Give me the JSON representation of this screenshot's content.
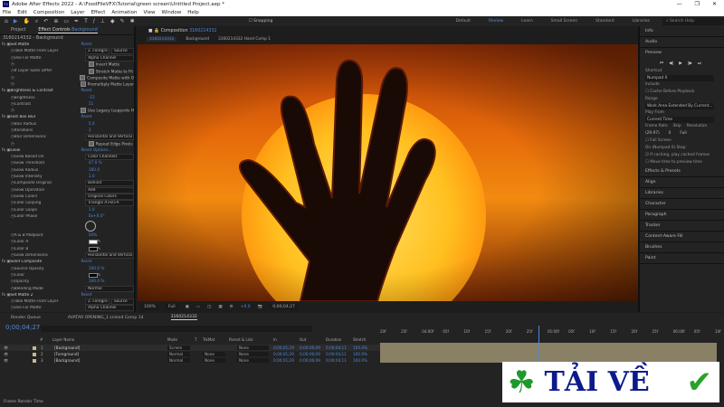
{
  "title": "Adobe After Effects 2022 - A:\\FoodFileVFX\\Tutorial\\green screen\\Untitled Project.aep *",
  "window_controls": [
    "—",
    "❐",
    "✕"
  ],
  "menu": [
    "File",
    "Edit",
    "Composition",
    "Layer",
    "Effect",
    "Animation",
    "View",
    "Window",
    "Help"
  ],
  "toolbar": {
    "snapping": "Snapping",
    "workspaces": [
      "Default",
      "Review",
      "Learn",
      "Small Screen",
      "Standard",
      "Libraries"
    ],
    "active_workspace": "Review",
    "search_placeholder": "Search Help"
  },
  "left_panel": {
    "tabs": [
      "Project",
      "Effect Controls"
    ],
    "effect_controls_layer": "Background",
    "layer_title": "3160214332 - Background",
    "rows": [
      {
        "t": "fx",
        "n": "Set Matte",
        "v": "Reset"
      },
      {
        "t": "dd2",
        "n": "Take Matte From Layer",
        "v": "2. Foregro",
        "v2": "Source"
      },
      {
        "t": "dd",
        "n": "Use For Matte",
        "v": "Alpha Channel"
      },
      {
        "t": "cb",
        "n": "",
        "v": "Invert Matte"
      },
      {
        "t": "cb",
        "n": "If Layer Sizes Differ",
        "v": "Stretch Matte to Fit"
      },
      {
        "t": "cb",
        "n": "",
        "v": "Composite Matte with O"
      },
      {
        "t": "cb",
        "n": "",
        "v": "Premultiply Matte Layer"
      },
      {
        "t": "fx",
        "n": "Brightness & Contrast",
        "v": "Reset"
      },
      {
        "t": "val",
        "n": "Brightness",
        "v": "-15"
      },
      {
        "t": "val",
        "n": "Contrast",
        "v": "11"
      },
      {
        "t": "cb",
        "n": "",
        "v": "Use Legacy (supports H"
      },
      {
        "t": "fx",
        "n": "Fast Box Blur",
        "v": "Reset"
      },
      {
        "t": "val",
        "n": "Blur Radius",
        "v": "5.0"
      },
      {
        "t": "val",
        "n": "Iterations",
        "v": "3"
      },
      {
        "t": "dd",
        "n": "Blur Dimensions",
        "v": "Horizontal and Vertical"
      },
      {
        "t": "cb",
        "n": "",
        "v": "Repeat Edge Pixels"
      },
      {
        "t": "fx",
        "n": "Glow",
        "v": "Reset   Options..."
      },
      {
        "t": "dd",
        "n": "Glow Based On",
        "v": "Color Channels"
      },
      {
        "t": "val",
        "n": "Glow Threshold",
        "v": "47.0 %"
      },
      {
        "t": "val",
        "n": "Glow Radius",
        "v": "160.0"
      },
      {
        "t": "val",
        "n": "Glow Intensity",
        "v": "1.0"
      },
      {
        "t": "dd",
        "n": "Composite Original",
        "v": "Behind"
      },
      {
        "t": "dd",
        "n": "Glow Operation",
        "v": "Add"
      },
      {
        "t": "dd",
        "n": "Glow Colors",
        "v": "Original Colors"
      },
      {
        "t": "dd",
        "n": "Color Looping",
        "v": "Triangle A>B>A"
      },
      {
        "t": "val",
        "n": "Color Loops",
        "v": "1.0"
      },
      {
        "t": "val",
        "n": "Color Phase",
        "v": "0x+0.0°"
      },
      {
        "t": "dial",
        "n": "",
        "v": ""
      },
      {
        "t": "val",
        "n": "A & B Midpoint",
        "v": "50%"
      },
      {
        "t": "sw",
        "n": "Color A",
        "v": "#ffffff"
      },
      {
        "t": "sw",
        "n": "Color B",
        "v": "#000000"
      },
      {
        "t": "dd",
        "n": "Glow Dimensions",
        "v": "Horizontal and Vertical"
      },
      {
        "t": "fx",
        "n": "Solid Composite",
        "v": "Reset"
      },
      {
        "t": "val",
        "n": "Source Opacity",
        "v": "100.0 %"
      },
      {
        "t": "sw",
        "n": "Color",
        "v": "#000000"
      },
      {
        "t": "val",
        "n": "Opacity",
        "v": "100.0 %"
      },
      {
        "t": "dd",
        "n": "Blending Mode",
        "v": "Normal"
      },
      {
        "t": "fx",
        "n": "Set Matte 2",
        "v": "Reset"
      },
      {
        "t": "dd2",
        "n": "Take Matte From Layer",
        "v": "2. Foregro",
        "v2": "Source"
      },
      {
        "t": "dd",
        "n": "Use For Matte",
        "v": "Alpha Channel"
      }
    ]
  },
  "composition": {
    "tab_label": "Composition",
    "comp_name": "3160214332",
    "breadcrumbs": [
      "3160214332",
      "Background",
      "3160214332 Hand Comp 1"
    ],
    "viewer_bar": {
      "zoom": "100%",
      "resolution": "Full",
      "exposure": "+0.0",
      "time": "0;00;04;27"
    }
  },
  "right_panel": {
    "sections_top": [
      "Info",
      "Audio"
    ],
    "preview": "Preview",
    "transport": [
      "⏮",
      "◀|",
      "▶",
      "|▶",
      "⏭"
    ],
    "shortcut_label": "Shortcut",
    "shortcut": "Numpad 0",
    "include_label": "Include",
    "cache_before": "Cache Before Playback",
    "range_label": "Range",
    "range": "Work Area Extended By Current...",
    "play_from_label": "Play From",
    "play_from": "Current Time",
    "frame_rate_label": "Frame Rate",
    "skip_label": "Skip",
    "resolution_label": "Resolution",
    "frame_rate": "(29.97)",
    "skip": "0",
    "resolution": "Full",
    "full_screen": "Full Screen",
    "on_stop_label": "On (Numpad 0) Stop:",
    "if_caching": "If caching, play cached frames",
    "move_time": "Move time to preview time",
    "panels": [
      "Effects & Presets",
      "Align",
      "Libraries",
      "Character",
      "Paragraph",
      "Tracker",
      "Content-Aware Fill",
      "Brushes",
      "Paint"
    ]
  },
  "timeline": {
    "tabs": [
      "Render Queue",
      "AVATAR OPENING_1 Linked Comp 14",
      "3160214332"
    ],
    "timecode": "0;00;04;27",
    "columns": [
      "#",
      "Layer Name",
      "Mode",
      "T",
      "TrkMat",
      "Parent & Link",
      "In",
      "Out",
      "Duration",
      "Stretch"
    ],
    "layers": [
      {
        "num": "1",
        "name": "[Background]",
        "mode": "Screen",
        "trkmat": "",
        "parent": "None",
        "in": "0;00;01;29",
        "out": "0;00;06;09",
        "dur": "0;00;04;11",
        "stretch": "100.0%"
      },
      {
        "num": "2",
        "name": "[Foreground]",
        "mode": "Normal",
        "trkmat": "None",
        "parent": "None",
        "in": "0;00;01;29",
        "out": "0;00;06;09",
        "dur": "0;00;04;11",
        "stretch": "100.0%"
      },
      {
        "num": "3",
        "name": "[Background]",
        "mode": "Normal",
        "trkmat": "None",
        "parent": "None",
        "in": "0;00;01;29",
        "out": "0;00;06;09",
        "dur": "0;00;04;11",
        "stretch": "100.0%"
      }
    ],
    "ruler": [
      "20f",
      "25f",
      "04:00f",
      "05f",
      "10f",
      "15f",
      "20f",
      "25f",
      "05:00f",
      "05f",
      "10f",
      "15f",
      "20f",
      "25f",
      "06:00f",
      "05f",
      "10f"
    ],
    "frame_render_time": "Frame Render Time"
  },
  "watermark": {
    "text": "TẢI VỀ"
  },
  "colors": {
    "accent": "#4d8ad6",
    "panel": "#232323",
    "track": "#8a8065"
  }
}
